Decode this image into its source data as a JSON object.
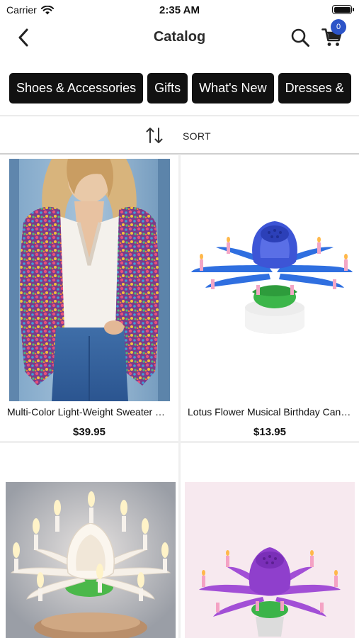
{
  "status_bar": {
    "carrier": "Carrier",
    "time": "2:35 AM"
  },
  "nav": {
    "title": "Catalog",
    "cart_count": "0"
  },
  "categories": [
    "Shoes & Accessories",
    "Gifts",
    "What's New",
    "Dresses &"
  ],
  "sort": {
    "label": "SORT"
  },
  "products": [
    {
      "name": "Multi-Color Light-Weight Sweater Cardigan",
      "price": "$39.95"
    },
    {
      "name": "Lotus Flower Musical Birthday Candle",
      "price": "$13.95"
    },
    {
      "name": "",
      "price": ""
    },
    {
      "name": "",
      "price": ""
    }
  ],
  "colors": {
    "badge": "#2c54c8",
    "chip_bg": "#111111"
  }
}
